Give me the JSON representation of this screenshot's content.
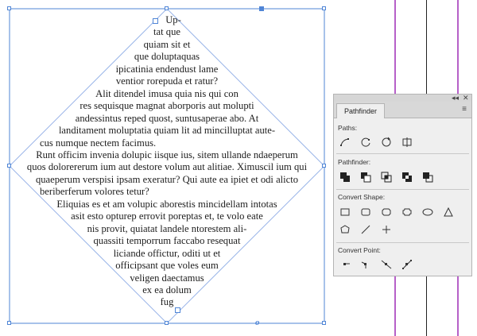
{
  "document": {
    "lines": [
      "Up-",
      "tat que",
      "quiam sit et",
      "que doluptaquas",
      "ipicatinia endendust lame",
      "ventior rorepuda et ratur?",
      "Alit ditendel imusa quia nis qui con",
      "res sequisque magnat aborporis aut molupti",
      "andessintus reped quost, suntusaperae abo. At",
      "landitament moluptatia quiam lit ad mincilluptat aute-",
      "cus numque nectem facimus.",
      "Runt officim invenia dolupic iisque ius, sitem ullande ndaeperum",
      "quos dolorererum ium aut destore volum aut alitiae. Ximuscil ium qui",
      "quaeperum verspisi ipsam exeratur? Qui aute ea ipiet et odi alicto",
      "beriberferum volores tetur?",
      "Eliquias es et am volupic aborestis mincidellam intotas",
      "asit esto opturep errovit poreptas et, te volo eate",
      "nis provit, quiatat landele ntorestem ali-",
      "quassiti temporrum faccabo resequat",
      "liciande offictur, oditi ut et",
      "officipsant que voles eum",
      "veligen daectamus",
      "ex ea dolum",
      "fug"
    ]
  },
  "panel": {
    "close_glyph": "✕",
    "collapse_glyph": "◂◂",
    "menu_glyph": "≡",
    "tab_label": "Pathfinder",
    "sections": {
      "paths": "Paths:",
      "pathfinder": "Pathfinder:",
      "convert_shape": "Convert Shape:",
      "convert_point": "Convert Point:"
    }
  },
  "colors": {
    "selection": "#4f85d6",
    "guide": "#b660c8",
    "panel_bg": "#efefef"
  }
}
